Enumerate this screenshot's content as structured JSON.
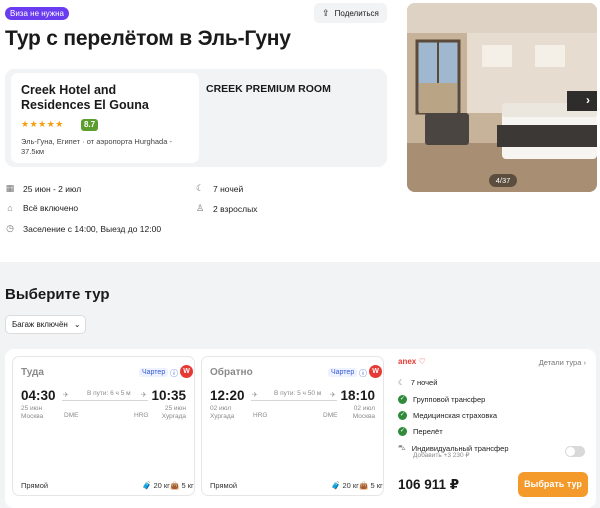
{
  "badge": "Виза не нужна",
  "share": {
    "label": "Поделиться",
    "icon": "share-icon"
  },
  "title": "Тур с перелётом в Эль-Гуну",
  "hotel": {
    "name": "Creek Hotel and Residences El Gouna",
    "stars": 5,
    "stars_text": "★★★★★",
    "rating": "8.7",
    "location": "Эль-Гуна, Египет · от аэропорта Hurghada - 37.5км"
  },
  "room": "CREEK PREMIUM ROOM",
  "info": {
    "dates": "25 июн - 2 июл",
    "nights": "7 ночей",
    "meals": "Всё включено",
    "guests": "2 взрослых",
    "checkin": "Заселение с 14:00, Выезд до 12:00"
  },
  "photo": {
    "counter": "4/37",
    "next": "›"
  },
  "choose": {
    "title": "Выберите тур",
    "baggage": "Багаж включён"
  },
  "outbound": {
    "label": "Туда",
    "charter": "Чартер",
    "airline_logo": "W",
    "dep_time": "04:30",
    "dep_date": "25 июн",
    "dep_city": "Москва",
    "dep_code": "DME",
    "arr_time": "10:35",
    "arr_date": "25 июн",
    "arr_city": "Хургада",
    "arr_code": "HRG",
    "duration": "В пути: 6 ч 5 м",
    "stops": "Прямой",
    "bag_checked": "20 кг",
    "bag_hand": "5 кг"
  },
  "return": {
    "label": "Обратно",
    "charter": "Чартер",
    "airline_logo": "W",
    "dep_time": "12:20",
    "dep_date": "02 июл",
    "dep_city": "Хургада",
    "dep_code": "HRG",
    "arr_time": "18:10",
    "arr_date": "02 июл",
    "arr_city": "Москва",
    "arr_code": "DME",
    "duration": "В пути: 5 ч 50 м",
    "stops": "Прямой",
    "bag_checked": "20 кг",
    "bag_hand": "5 кг"
  },
  "offer": {
    "operator": "anex ♡",
    "details": "Детали тура ›",
    "nights": "7 ночей",
    "features": [
      "Групповой трансфер",
      "Медицинская страховка",
      "Перелёт"
    ],
    "transfer": "Индивидуальный трансфер",
    "transfer_add": "Добавить +3 230 ₽",
    "price": "106 911 ₽",
    "button": "Выбрать тур"
  },
  "colors": {
    "accent": "#6a3cf0",
    "primary_button": "#f39a2b",
    "rating": "#5c9e2e",
    "check": "#2e8b3a",
    "charter": "#2f5bd8"
  }
}
